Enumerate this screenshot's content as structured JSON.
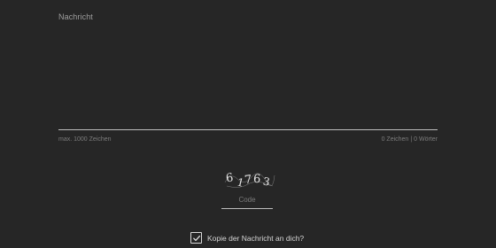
{
  "form": {
    "message": {
      "label": "Nachricht",
      "value": "",
      "max_hint": "max. 1000 Zeichen",
      "char_count": "0 Zeichen",
      "separator": "|",
      "word_count": "0 Wörter"
    },
    "captcha": {
      "text": "61763",
      "glyphs": [
        "6",
        "1",
        "7",
        "6",
        "3"
      ],
      "code_label": "Code",
      "code_value": ""
    },
    "copy_option": {
      "label": "Kopie der Nachricht an dich?",
      "checked": true
    }
  }
}
